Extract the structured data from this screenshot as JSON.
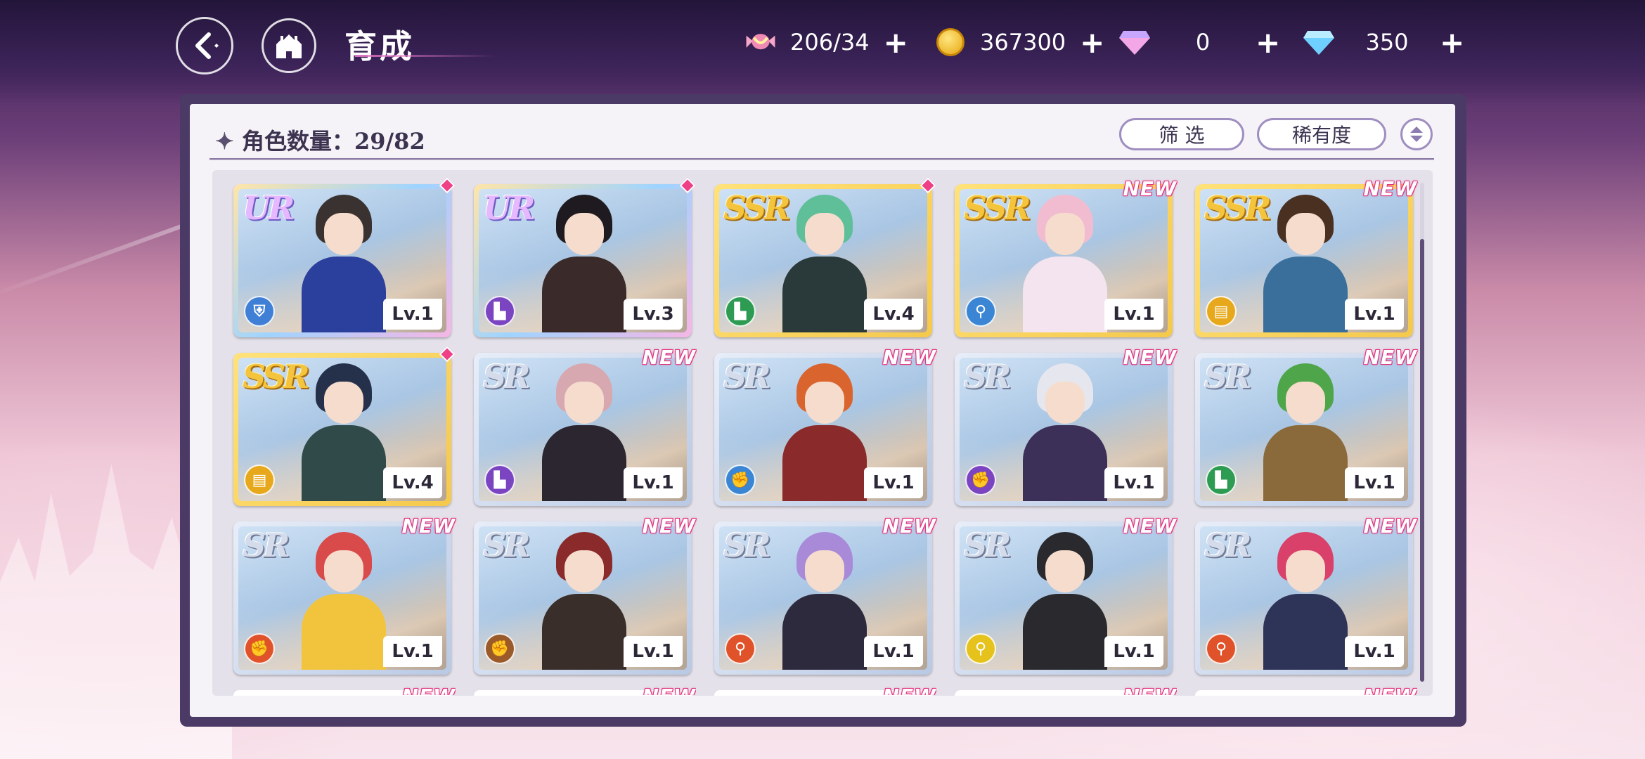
{
  "header": {
    "title": "育成",
    "resources": [
      {
        "icon": "candy-icon",
        "value": "206/34"
      },
      {
        "icon": "gold-coin-icon",
        "value": "367300"
      },
      {
        "icon": "pink-gem-icon",
        "value": "0"
      },
      {
        "icon": "blue-diamond-icon",
        "value": "350"
      }
    ]
  },
  "panel": {
    "count_label": "角色数量：29/82",
    "filter_label": "筛 选",
    "sort_label": "稀有度"
  },
  "colors": {
    "ur_accent": "#b99cff",
    "ssr_accent": "#f3c43c",
    "sr_accent": "#b9c9e4",
    "new_tag": "#e2337f"
  },
  "cards": [
    {
      "rarity": "UR",
      "level": "Lv.1",
      "badge": "dot",
      "class_icon": "shield-icon",
      "class_color": "#3f7fd6",
      "hair": "#3a3230",
      "outfit": "#2b3f9c"
    },
    {
      "rarity": "UR",
      "level": "Lv.3",
      "badge": "dot",
      "class_icon": "boot-icon",
      "class_color": "#7b45c2",
      "hair": "#1e1a20",
      "outfit": "#3a2a2a"
    },
    {
      "rarity": "SSR",
      "level": "Lv.4",
      "badge": "dot",
      "class_icon": "boot-icon",
      "class_color": "#2e9b53",
      "hair": "#5fbf98",
      "outfit": "#2a3a3a"
    },
    {
      "rarity": "SSR",
      "level": "Lv.1",
      "badge": "NEW",
      "class_icon": "wand-icon",
      "class_color": "#3b86d4",
      "hair": "#f2bcd0",
      "outfit": "#f4e4ef"
    },
    {
      "rarity": "SSR",
      "level": "Lv.1",
      "badge": "NEW",
      "class_icon": "book-icon",
      "class_color": "#e7a81c",
      "hair": "#4a3020",
      "outfit": "#3a6f9c"
    },
    {
      "rarity": "SSR",
      "level": "Lv.4",
      "badge": "dot",
      "class_icon": "book-icon",
      "class_color": "#e7a81c",
      "hair": "#25304a",
      "outfit": "#2f4a48"
    },
    {
      "rarity": "SR",
      "level": "Lv.1",
      "badge": "NEW",
      "class_icon": "boot-icon",
      "class_color": "#7b45c2",
      "hair": "#d8a8b0",
      "outfit": "#2c2630"
    },
    {
      "rarity": "SR",
      "level": "Lv.1",
      "badge": "NEW",
      "class_icon": "fist-icon",
      "class_color": "#3b86d4",
      "hair": "#d9642e",
      "outfit": "#8a2a2a"
    },
    {
      "rarity": "SR",
      "level": "Lv.1",
      "badge": "NEW",
      "class_icon": "fist-icon",
      "class_color": "#7b45c2",
      "hair": "#e6e6ee",
      "outfit": "#3c2f58"
    },
    {
      "rarity": "SR",
      "level": "Lv.1",
      "badge": "NEW",
      "class_icon": "boot-icon",
      "class_color": "#2e9b53",
      "hair": "#4fa64a",
      "outfit": "#8a6a3a"
    },
    {
      "rarity": "SR",
      "level": "Lv.1",
      "badge": "NEW",
      "class_icon": "fist-icon",
      "class_color": "#e0532a",
      "hair": "#d94a4a",
      "outfit": "#f2c43e"
    },
    {
      "rarity": "SR",
      "level": "Lv.1",
      "badge": "NEW",
      "class_icon": "fist-icon",
      "class_color": "#9a5a2a",
      "hair": "#8a2a2a",
      "outfit": "#3a2e2a"
    },
    {
      "rarity": "SR",
      "level": "Lv.1",
      "badge": "NEW",
      "class_icon": "wand-icon",
      "class_color": "#e0532a",
      "hair": "#a88ad8",
      "outfit": "#2e2a3e"
    },
    {
      "rarity": "SR",
      "level": "Lv.1",
      "badge": "NEW",
      "class_icon": "wand-icon",
      "class_color": "#e6c21c",
      "hair": "#2a2a2e",
      "outfit": "#2a2a2e"
    },
    {
      "rarity": "SR",
      "level": "Lv.1",
      "badge": "NEW",
      "class_icon": "wand-icon",
      "class_color": "#e0532a",
      "hair": "#d9406a",
      "outfit": "#2e3458"
    }
  ],
  "partial_row_badges": [
    "NEW",
    "NEW",
    "NEW",
    "NEW",
    "NEW"
  ]
}
